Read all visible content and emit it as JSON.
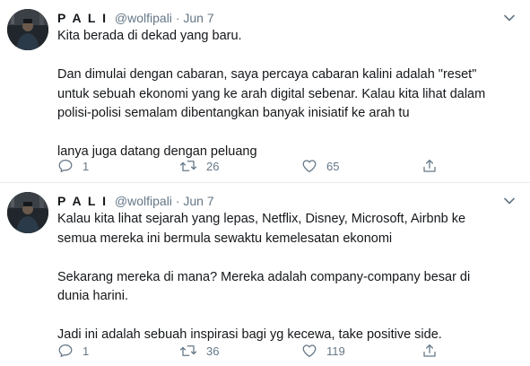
{
  "tweets": [
    {
      "author_name": "P A L I",
      "handle": "@wolfipali",
      "separator": "·",
      "date": "Jun 7",
      "paragraphs": [
        [
          "Kita berada di dekad yang baru."
        ],
        [
          "Dan dimulai dengan cabaran, saya percaya cabaran kalini adalah \"reset\"",
          "untuk sebuah ekonomi yang ke arah digital sebenar. Kalau kita lihat dalam",
          "polisi-polisi semalam dibentangkan banyak inisiatif ke arah tu"
        ],
        [
          "lanya juga datang dengan peluang"
        ]
      ],
      "replies": "1",
      "retweets": "26",
      "likes": "65"
    },
    {
      "author_name": "P A L I",
      "handle": "@wolfipali",
      "separator": "·",
      "date": "Jun 7",
      "paragraphs": [
        [
          "Kalau kita lihat sejarah yang lepas, Netflix, Disney, Microsoft, Airbnb ke",
          "semua mereka ini bermula sewaktu kemelesatan ekonomi"
        ],
        [
          "Sekarang mereka di mana? Mereka adalah company-company besar di",
          "dunia harini."
        ],
        [
          "Jadi ini adalah sebuah inspirasi bagi yg kecewa, take positive side."
        ]
      ],
      "replies": "1",
      "retweets": "36",
      "likes": "119"
    }
  ],
  "icons": {
    "caret": "chevron-down-icon",
    "reply": "reply-icon",
    "retweet": "retweet-icon",
    "like": "heart-icon",
    "share": "share-icon"
  },
  "colors": {
    "text": "#14171a",
    "muted": "#657786",
    "divider": "#e6ecf0"
  }
}
